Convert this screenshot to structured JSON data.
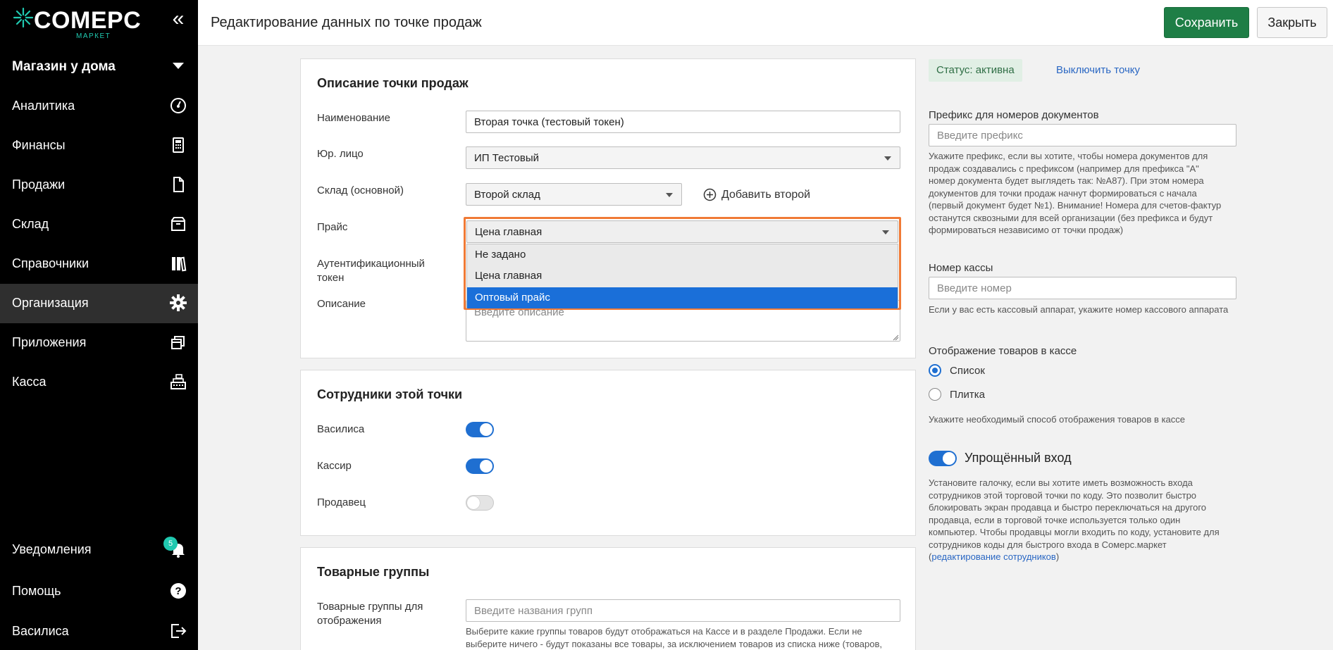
{
  "app": {
    "logo_text": "COMEPC",
    "logo_sub": "МАРКЕТ",
    "store_name": "Магазин у дома"
  },
  "sidebar": {
    "items": [
      {
        "label": "Аналитика",
        "icon": "dashboard-icon"
      },
      {
        "label": "Финансы",
        "icon": "calculator-icon"
      },
      {
        "label": "Продажи",
        "icon": "document-icon"
      },
      {
        "label": "Склад",
        "icon": "box-icon"
      },
      {
        "label": "Справочники",
        "icon": "books-icon"
      },
      {
        "label": "Организация",
        "icon": "gear-icon"
      },
      {
        "label": "Приложения",
        "icon": "windows-icon"
      },
      {
        "label": "Касса",
        "icon": "cash-register-icon"
      }
    ],
    "bottom": [
      {
        "label": "Уведомления",
        "icon": "bell-icon",
        "badge": "5"
      },
      {
        "label": "Помощь",
        "icon": "help-icon"
      },
      {
        "label": "Василиса",
        "icon": "logout-icon"
      }
    ]
  },
  "header": {
    "title": "Редактирование данных по точке продаж",
    "save_label": "Сохранить",
    "close_label": "Закрыть"
  },
  "description_card": {
    "title": "Описание точки продаж",
    "name_label": "Наименование",
    "name_value": "Вторая точка (тестовый токен)",
    "legal_label": "Юр. лицо",
    "legal_value": "ИП Тестовый",
    "warehouse_label": "Склад (основной)",
    "warehouse_value": "Второй склад",
    "add_second_label": "Добавить второй",
    "price_label": "Прайс",
    "price_value": "Цена главная",
    "price_options": [
      "Не задано",
      "Цена главная",
      "Оптовый прайс"
    ],
    "price_highlighted": "Оптовый прайс",
    "auth_label_1": "Аутентификационный",
    "auth_label_2": "токен",
    "desc_label": "Описание",
    "desc_placeholder": "Введите описание"
  },
  "employees_card": {
    "title": "Сотрудники этой точки",
    "employees": [
      {
        "name": "Василиса",
        "enabled": true
      },
      {
        "name": "Кассир",
        "enabled": true
      },
      {
        "name": "Продавец",
        "enabled": false
      }
    ]
  },
  "groups_card": {
    "title": "Товарные группы",
    "label_1": "Товарные группы для",
    "label_2": "отображения",
    "placeholder": "Введите названия групп",
    "help_1": "Выберите какие группы товаров будут отображаться на Кассе и в разделе Продажи. Если не",
    "help_2": "выберите ничего - будут показаны все товары, за исключением товаров из списка ниже (товаров,"
  },
  "right": {
    "status": "Статус: активна",
    "disable_link": "Выключить точку",
    "prefix_label": "Префикс для номеров документов",
    "prefix_placeholder": "Введите префикс",
    "prefix_help": [
      "Укажите префикс, если вы хотите, чтобы номера документов для",
      "продаж создавались с префиксом (например для префикса \"А\"",
      "номер документа будет выглядеть так: №А87). При этом номера",
      "документов для точки продаж начнут формироваться с начала",
      "(первый документ будет №1). Внимание! Номера для счетов-фактур",
      "останутся сквозными для всей организации (без префикса и будут",
      "формироваться независимо от точки продаж)"
    ],
    "cash_label": "Номер кассы",
    "cash_placeholder": "Введите номер",
    "cash_help": "Если у вас есть кассовый аппарат, укажите номер кассового аппарата",
    "display_label": "Отображение товаров в кассе",
    "display_options": [
      "Список",
      "Плитка"
    ],
    "display_selected": "Список",
    "display_help": "Укажите необходимый способ отображения товаров в кассе",
    "simple_login_label": "Упрощённый вход",
    "simple_login_enabled": true,
    "simple_help": [
      "Установите галочку, если вы хотите иметь возможность входа",
      "сотрудников этой торговой точки по коду. Это позволит быстро",
      "блокировать экран продавца и быстро переключаться на другого",
      "продавца, если в торговой точке используется только один",
      "компьютер. Чтобы продавцы могли входить по коду, установите для",
      "сотрудников коды для быстрого входа в Сомерс.маркет"
    ],
    "simple_help_link": "редактирование сотрудников",
    "paren_open": "(",
    "paren_close": ")"
  }
}
